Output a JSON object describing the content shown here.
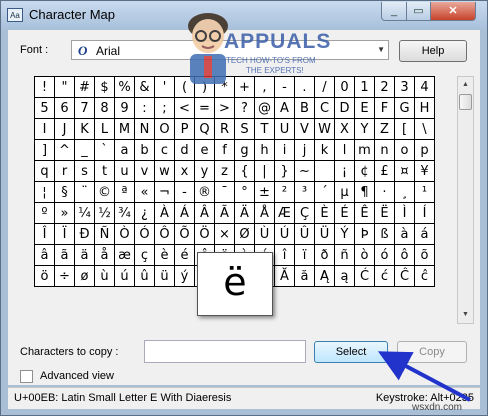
{
  "window": {
    "title": "Character Map",
    "icon": "character-map-icon"
  },
  "font": {
    "label": "Font :",
    "value": "Arial",
    "icon_glyph": "O",
    "help_label": "Help"
  },
  "grid": {
    "rows": [
      [
        "!",
        "\"",
        "#",
        "$",
        "%",
        "&",
        "'",
        "(",
        ")",
        "*",
        "+",
        ",",
        "-",
        ".",
        "/",
        "0",
        "1",
        "2",
        "3",
        "4"
      ],
      [
        "5",
        "6",
        "7",
        "8",
        "9",
        ":",
        ";",
        "<",
        "=",
        ">",
        "?",
        "@",
        "A",
        "B",
        "C",
        "D",
        "E",
        "F",
        "G",
        "H"
      ],
      [
        "I",
        "J",
        "K",
        "L",
        "M",
        "N",
        "O",
        "P",
        "Q",
        "R",
        "S",
        "T",
        "U",
        "V",
        "W",
        "X",
        "Y",
        "Z",
        "[",
        "\\"
      ],
      [
        "]",
        "^",
        "_",
        "`",
        "a",
        "b",
        "c",
        "d",
        "e",
        "f",
        "g",
        "h",
        "i",
        "j",
        "k",
        "l",
        "m",
        "n",
        "o",
        "p"
      ],
      [
        "q",
        "r",
        "s",
        "t",
        "u",
        "v",
        "w",
        "x",
        "y",
        "z",
        "{",
        "|",
        "}",
        "~",
        " ",
        "¡",
        "¢",
        "£",
        "¤",
        "¥"
      ],
      [
        "¦",
        "§",
        "¨",
        "©",
        "ª",
        "«",
        "¬",
        "-",
        "®",
        "¯",
        "°",
        "±",
        "²",
        "³",
        "´",
        "µ",
        "¶",
        "·",
        "¸",
        "¹"
      ],
      [
        "º",
        "»",
        "¼",
        "½",
        "¾",
        "¿",
        "À",
        "Á",
        "Â",
        "Ã",
        "Ä",
        "Å",
        "Æ",
        "Ç",
        "È",
        "É",
        "Ê",
        "Ë",
        "Ì",
        "Í"
      ],
      [
        "Î",
        "Ï",
        "Ð",
        "Ñ",
        "Ò",
        "Ó",
        "Ô",
        "Õ",
        "Ö",
        "×",
        "Ø",
        "Ù",
        "Ú",
        "Û",
        "Ü",
        "Ý",
        "Þ",
        "ß",
        "à",
        "á"
      ],
      [
        "â",
        "ã",
        "ä",
        "å",
        "æ",
        "ç",
        "è",
        "é",
        "ê",
        "ë",
        "ì",
        "í",
        "î",
        "ï",
        "ð",
        "ñ",
        "ò",
        "ó",
        "ô",
        "õ"
      ],
      [
        "ö",
        "÷",
        "ø",
        "ù",
        "ú",
        "û",
        "ü",
        "ý",
        "þ",
        "ÿ",
        "Ā",
        "ā",
        "Ă",
        "ă",
        "Ą",
        "ą",
        "Ć",
        "ć",
        "Ĉ",
        "ĉ"
      ]
    ],
    "zoomed_char": "ë"
  },
  "copy": {
    "label": "Characters to copy :",
    "value": "",
    "select_label": "Select",
    "copy_label": "Copy"
  },
  "advanced": {
    "label": "Advanced view",
    "checked": false
  },
  "status": {
    "left": "U+00EB: Latin Small Letter E With Diaeresis",
    "right": "Keystroke: Alt+0235"
  },
  "watermark": {
    "brand": "APPUALS",
    "tagline1": "TECH HOW-TO'S FROM",
    "tagline2": "THE EXPERTS!",
    "site": "wsxdn.com"
  },
  "colors": {
    "accent": "#3c7fb1",
    "arrow": "#2233cc",
    "watermark": "#3a5ea8"
  }
}
